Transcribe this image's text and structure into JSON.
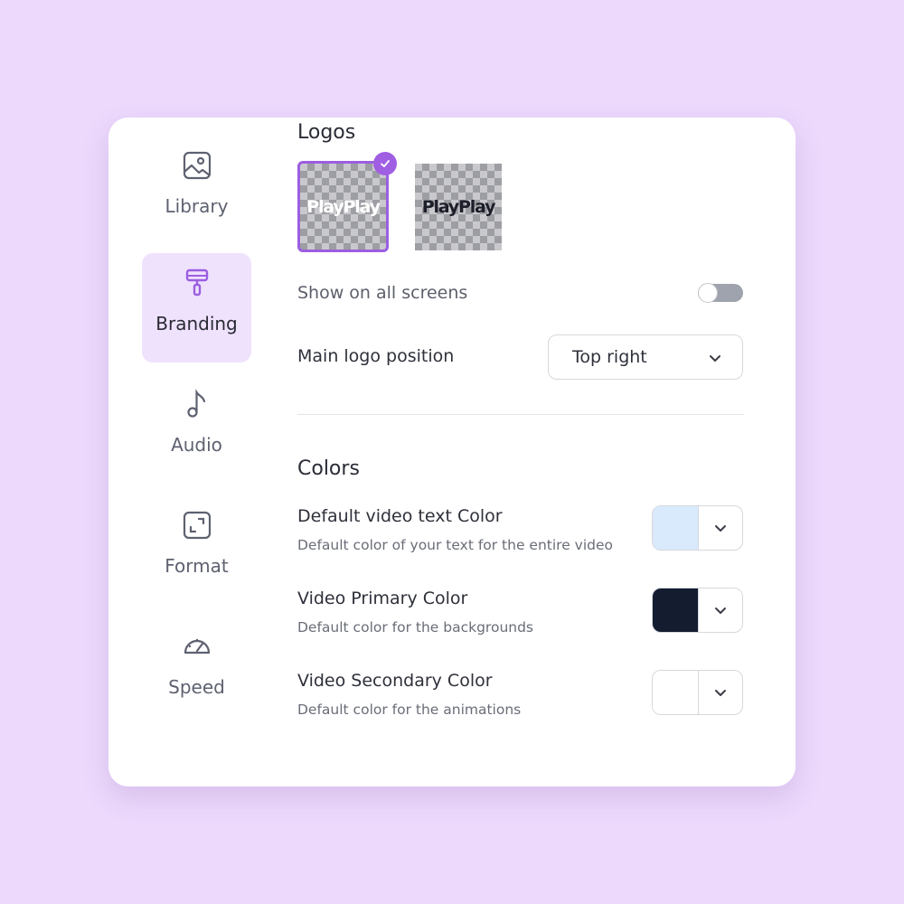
{
  "sidebar": {
    "items": [
      {
        "label": "Library",
        "icon": "image-icon",
        "active": false
      },
      {
        "label": "Branding",
        "icon": "paint-roller-icon",
        "active": true
      },
      {
        "label": "Audio",
        "icon": "music-note-icon",
        "active": false
      },
      {
        "label": "Format",
        "icon": "resize-icon",
        "active": false
      },
      {
        "label": "Speed",
        "icon": "speedometer-icon",
        "active": false
      }
    ]
  },
  "logos": {
    "title": "Logos",
    "items": [
      {
        "text": "PlayPlay",
        "variant": "light",
        "selected": true
      },
      {
        "text": "PlayPlay",
        "variant": "dark",
        "selected": false
      }
    ],
    "show_on_all_screens_label": "Show on all screens",
    "show_on_all_screens": false,
    "position_label": "Main logo position",
    "position_value": "Top right"
  },
  "colors": {
    "title": "Colors",
    "items": [
      {
        "title": "Default video text Color",
        "description": "Default color of your text for the entire video",
        "color": "#d8eafc"
      },
      {
        "title": "Video Primary Color",
        "description": "Default color for the backgrounds",
        "color": "#141c30"
      },
      {
        "title": "Video Secondary Color",
        "description": "Default color for the animations",
        "color": "#ffffff"
      }
    ]
  },
  "theme": {
    "accent": "#9b5fe0",
    "active_bg": "#efe2fd",
    "page_bg": "#ecd9fc"
  }
}
